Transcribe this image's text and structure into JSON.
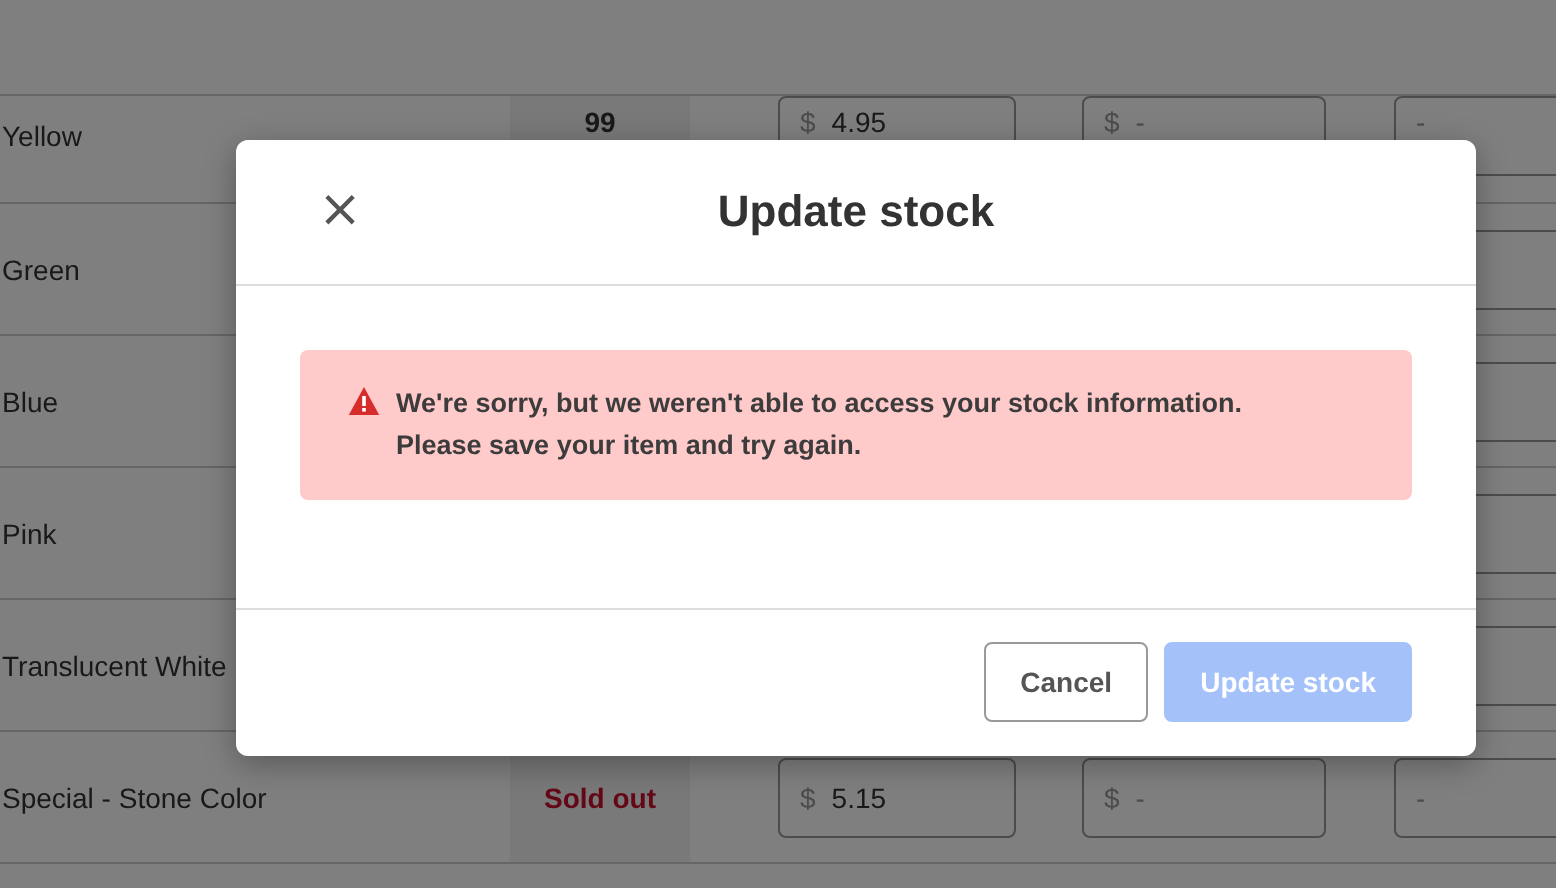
{
  "table": {
    "rows": [
      {
        "name": "Yellow",
        "stock": {
          "kind": "count",
          "text": "99"
        },
        "price": {
          "currency": "$",
          "value": "4.95"
        },
        "sale_price": {
          "currency": "$",
          "placeholder": "-"
        },
        "column_5": {
          "placeholder": "-"
        }
      },
      {
        "name": "Green"
      },
      {
        "name": "Blue"
      },
      {
        "name": "Pink"
      },
      {
        "name": "Translucent White"
      },
      {
        "name": "Special - Stone Color",
        "stock": {
          "kind": "sold_out",
          "text": "Sold out"
        },
        "price": {
          "currency": "$",
          "value": "5.15"
        },
        "sale_price": {
          "currency": "$",
          "placeholder": "-"
        },
        "column_5": {
          "placeholder": "-"
        }
      }
    ]
  },
  "dialog": {
    "title": "Update stock",
    "close": "×",
    "alert": {
      "kind": "error",
      "lines": [
        "We're sorry, but we weren't able to access your stock information.",
        "Please save your item and try again."
      ]
    },
    "buttons": [
      {
        "kind": "secondary",
        "label": "Cancel",
        "disabled": false
      },
      {
        "kind": "primary",
        "label": "Update stock",
        "disabled": true
      }
    ]
  }
}
